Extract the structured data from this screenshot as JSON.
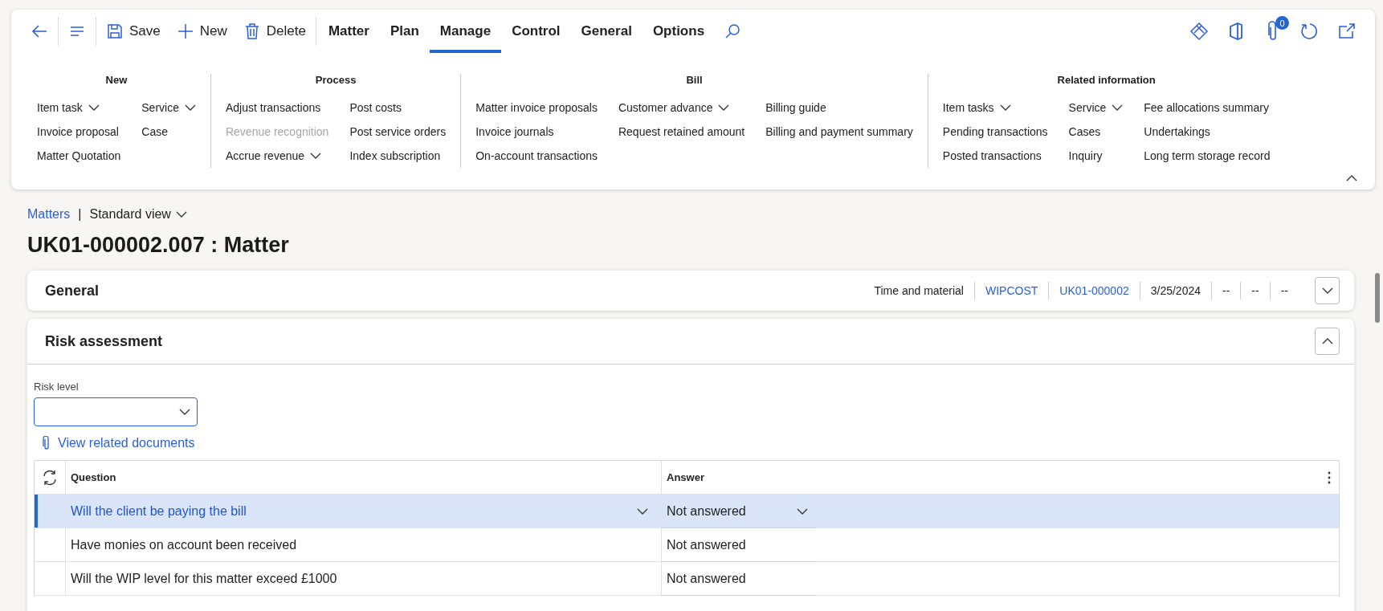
{
  "toolbar": {
    "actions": [
      {
        "kind": "back"
      },
      {
        "kind": "menu"
      },
      {
        "kind": "save",
        "label": "Save"
      },
      {
        "kind": "new",
        "label": "New"
      },
      {
        "kind": "delete",
        "label": "Delete"
      }
    ],
    "tabs": [
      {
        "label": "Matter",
        "selected": false
      },
      {
        "label": "Plan",
        "selected": false
      },
      {
        "label": "Manage",
        "selected": true
      },
      {
        "label": "Control",
        "selected": false
      },
      {
        "label": "General",
        "selected": false
      },
      {
        "label": "Options",
        "selected": false
      }
    ],
    "attachments_count": "0"
  },
  "ribbon": {
    "groups": [
      {
        "title": "New",
        "columns": [
          [
            {
              "label": "Item task",
              "dropdown": true,
              "disabled": false
            },
            {
              "label": "Invoice proposal",
              "dropdown": false,
              "disabled": false
            },
            {
              "label": "Matter Quotation",
              "dropdown": false,
              "disabled": false
            }
          ],
          [
            {
              "label": "Service",
              "dropdown": true,
              "disabled": false
            },
            {
              "label": "Case",
              "dropdown": false,
              "disabled": false
            }
          ]
        ]
      },
      {
        "title": "Process",
        "columns": [
          [
            {
              "label": "Adjust transactions",
              "dropdown": false,
              "disabled": false
            },
            {
              "label": "Revenue recognition",
              "dropdown": false,
              "disabled": true
            },
            {
              "label": "Accrue revenue",
              "dropdown": true,
              "disabled": false
            }
          ],
          [
            {
              "label": "Post costs",
              "dropdown": false,
              "disabled": false
            },
            {
              "label": "Post service orders",
              "dropdown": false,
              "disabled": false
            },
            {
              "label": "Index subscription",
              "dropdown": false,
              "disabled": false
            }
          ]
        ]
      },
      {
        "title": "Bill",
        "columns": [
          [
            {
              "label": "Matter invoice proposals",
              "dropdown": false,
              "disabled": false
            },
            {
              "label": "Invoice journals",
              "dropdown": false,
              "disabled": false
            },
            {
              "label": "On-account transactions",
              "dropdown": false,
              "disabled": false
            }
          ],
          [
            {
              "label": "Customer advance",
              "dropdown": true,
              "disabled": false
            },
            {
              "label": "Request retained amount",
              "dropdown": false,
              "disabled": false
            }
          ],
          [
            {
              "label": "Billing guide",
              "dropdown": false,
              "disabled": false
            },
            {
              "label": "Billing and payment summary",
              "dropdown": false,
              "disabled": false
            }
          ]
        ]
      },
      {
        "title": "Related information",
        "columns": [
          [
            {
              "label": "Item tasks",
              "dropdown": true,
              "disabled": false
            },
            {
              "label": "Pending transactions",
              "dropdown": false,
              "disabled": false
            },
            {
              "label": "Posted transactions",
              "dropdown": false,
              "disabled": false
            }
          ],
          [
            {
              "label": "Service",
              "dropdown": true,
              "disabled": false
            },
            {
              "label": "Cases",
              "dropdown": false,
              "disabled": false
            },
            {
              "label": "Inquiry",
              "dropdown": false,
              "disabled": false
            }
          ],
          [
            {
              "label": "Fee allocations summary",
              "dropdown": false,
              "disabled": false
            },
            {
              "label": "Undertakings",
              "dropdown": false,
              "disabled": false
            },
            {
              "label": "Long term storage record",
              "dropdown": false,
              "disabled": false
            }
          ]
        ]
      }
    ]
  },
  "breadcrumb": {
    "link": "Matters",
    "separator": "|",
    "view": "Standard view"
  },
  "title": "UK01-000002.007 : Matter",
  "general": {
    "title": "General",
    "expanded": false,
    "summary": [
      {
        "text": "Time and material",
        "link": false
      },
      {
        "text": "WIPCOST",
        "link": true
      },
      {
        "text": "UK01-000002",
        "link": true
      },
      {
        "text": "3/25/2024",
        "link": false
      },
      {
        "text": "--",
        "link": false
      },
      {
        "text": "--",
        "link": false
      },
      {
        "text": "--",
        "link": false
      }
    ]
  },
  "risk_assessment": {
    "title": "Risk assessment",
    "expanded": true,
    "risk_level_label": "Risk level",
    "documents_link": "View related documents",
    "grid": {
      "columns": [
        "Question",
        "Answer"
      ],
      "rows": [
        {
          "question": "Will the client be paying the bill",
          "answer": "Not answered",
          "selected": true
        },
        {
          "question": "Have monies on account been received",
          "answer": "Not answered",
          "selected": false
        },
        {
          "question": "Will the WIP level for this matter exceed £1000",
          "answer": "Not answered",
          "selected": false
        }
      ]
    }
  }
}
